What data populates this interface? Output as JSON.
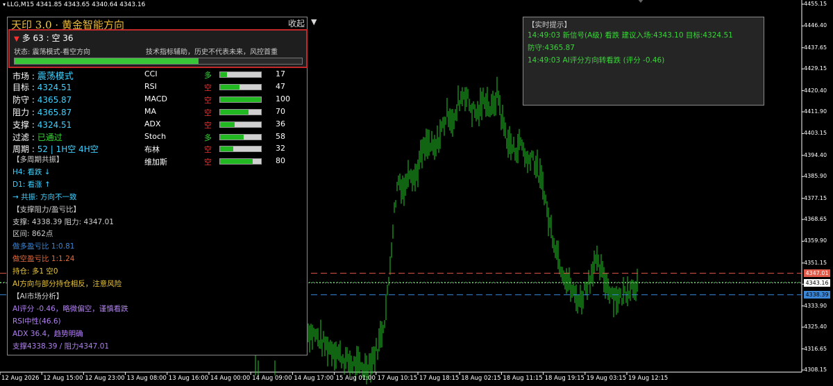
{
  "header": {
    "symbol_line": "LLG,M15  4341.85 4343.65 4340.64 4343.16"
  },
  "price_axis": {
    "labels": [
      "4455.15",
      "4446.40",
      "4437.65",
      "4429.15",
      "4420.40",
      "4411.90",
      "4403.15",
      "4394.40",
      "4385.90",
      "4377.15",
      "4368.65",
      "4359.90",
      "4351.15",
      "4342.65",
      "4333.90",
      "4325.40",
      "4316.65",
      "4308.15"
    ],
    "tags": [
      {
        "value": "4347.01",
        "color": "#e05a4a",
        "text_color": "#ffffff"
      },
      {
        "value": "4343.16",
        "color": "#ffffff",
        "text_color": "#000000"
      },
      {
        "value": "4338.39",
        "color": "#3b86d6",
        "text_color": "#000000"
      }
    ]
  },
  "time_axis": {
    "labels": [
      "12 Aug 2026",
      "12 Aug 15:00",
      "12 Aug 23:00",
      "13 Aug 08:00",
      "13 Aug 16:00",
      "14 Aug 00:00",
      "14 Aug 09:00",
      "14 Aug 17:00",
      "15 Aug 01:00",
      "17 Aug 10:15",
      "17 Aug 18:15",
      "18 Aug 02:15",
      "18 Aug 11:15",
      "18 Aug 19:15",
      "19 Aug 03:15",
      "19 Aug 12:15"
    ]
  },
  "chart_data": {
    "type": "candlestick",
    "symbol": "LLG",
    "timeframe": "M15",
    "ohlc_current": {
      "open": 4341.85,
      "high": 4343.65,
      "low": 4340.64,
      "close": 4343.16
    },
    "ylim": [
      4308.15,
      4455.15
    ],
    "candle_color": "#22c822",
    "background": "#000000",
    "grid": false,
    "horizontal_lines": [
      {
        "value": 4347.01,
        "style": "dashed",
        "color": "#e05a4a"
      },
      {
        "value": 4343.16,
        "style": "dotted",
        "color": "#9a9a9a"
      },
      {
        "value": 4338.39,
        "style": "dashed",
        "color": "#3b86d6"
      }
    ],
    "price_path": [
      [
        0.0,
        4324
      ],
      [
        0.03,
        4322
      ],
      [
        0.06,
        4318
      ],
      [
        0.09,
        4316
      ],
      [
        0.12,
        4312
      ],
      [
        0.15,
        4310
      ],
      [
        0.18,
        4309
      ],
      [
        0.2,
        4312
      ],
      [
        0.22,
        4318
      ],
      [
        0.24,
        4330
      ],
      [
        0.25,
        4342
      ],
      [
        0.26,
        4360
      ],
      [
        0.27,
        4375
      ],
      [
        0.28,
        4385
      ],
      [
        0.3,
        4380
      ],
      [
        0.31,
        4390
      ],
      [
        0.33,
        4385
      ],
      [
        0.35,
        4395
      ],
      [
        0.37,
        4399
      ],
      [
        0.39,
        4396
      ],
      [
        0.41,
        4405
      ],
      [
        0.43,
        4412
      ],
      [
        0.45,
        4407
      ],
      [
        0.46,
        4416
      ],
      [
        0.48,
        4420
      ],
      [
        0.5,
        4413
      ],
      [
        0.52,
        4411
      ],
      [
        0.54,
        4418
      ],
      [
        0.56,
        4412
      ],
      [
        0.58,
        4420
      ],
      [
        0.59,
        4410
      ],
      [
        0.61,
        4400
      ],
      [
        0.63,
        4396
      ],
      [
        0.65,
        4400
      ],
      [
        0.67,
        4391
      ],
      [
        0.68,
        4396
      ],
      [
        0.7,
        4388
      ],
      [
        0.72,
        4380
      ],
      [
        0.73,
        4370
      ],
      [
        0.75,
        4360
      ],
      [
        0.77,
        4350
      ],
      [
        0.79,
        4344
      ],
      [
        0.81,
        4338
      ],
      [
        0.83,
        4336
      ],
      [
        0.84,
        4340
      ],
      [
        0.86,
        4346
      ],
      [
        0.87,
        4352
      ],
      [
        0.89,
        4348
      ],
      [
        0.91,
        4342
      ],
      [
        0.93,
        4338
      ],
      [
        0.95,
        4337
      ],
      [
        0.97,
        4341
      ],
      [
        1.0,
        4343
      ]
    ]
  },
  "left_panel": {
    "title_prefix": "天印 ",
    "title_version": "3.0",
    "title_suffix": " · 黄金智能方向",
    "collapse_label": "收起",
    "collapse_arrow": "▼",
    "signal": {
      "arrow": "▼",
      "main": "多 63 : 空 36",
      "status": "状态: 震荡模式-看空方向",
      "note": "技术指标辅助，历史不代表未来，风控首重",
      "progress": 0.64
    },
    "stats": [
      {
        "label": "市场 : ",
        "value": "震荡模式",
        "style": "cyan-big"
      },
      {
        "label": "目标 : ",
        "value": "4324.51",
        "style": "cyan"
      },
      {
        "label": "防守 : ",
        "value": "4365.87",
        "style": "cyan"
      },
      {
        "label": "阻力 : ",
        "value": "4365.87",
        "style": "cyan"
      },
      {
        "label": "支撑 : ",
        "value": "4324.51",
        "style": "cyan"
      },
      {
        "label": "过滤 : ",
        "value": "已通过",
        "style": "green"
      },
      {
        "label": "周期 : ",
        "value": "52 | 1H空 4H空",
        "style": "cyan"
      }
    ],
    "indicators": [
      {
        "name": "CCI",
        "dir": "多",
        "dir_color": "#36d836",
        "value": 17,
        "label": "17"
      },
      {
        "name": "RSI",
        "dir": "空",
        "dir_color": "#ff2a2a",
        "value": 47,
        "label": "47"
      },
      {
        "name": "MACD",
        "dir": "空",
        "dir_color": "#ff2a2a",
        "value": 100,
        "label": "100"
      },
      {
        "name": "MA",
        "dir": "空",
        "dir_color": "#ff2a2a",
        "value": 70,
        "label": "70"
      },
      {
        "name": "ADX",
        "dir": "空",
        "dir_color": "#ff2a2a",
        "value": 36,
        "label": "36"
      },
      {
        "name": "Stoch",
        "dir": "多",
        "dir_color": "#36d836",
        "value": 58,
        "label": "58"
      },
      {
        "name": "布林",
        "dir": "空",
        "dir_color": "#ff2a2a",
        "value": 32,
        "label": "32"
      },
      {
        "name": "维加斯",
        "dir": "空",
        "dir_color": "#ff2a2a",
        "value": 80,
        "label": "80"
      }
    ],
    "sections": [
      {
        "text": "【多周期共振】",
        "color": "#d0d0d0"
      },
      {
        "text": "H4: 看跌 ↓",
        "color": "#3ed1ff"
      },
      {
        "text": "D1: 看涨 ↑",
        "color": "#3ed1ff"
      },
      {
        "text": "→ 共振: 方向不一致",
        "color": "#3ed1ff"
      },
      {
        "text": "【支撑阻力/盈亏比】",
        "color": "#d0d0d0"
      },
      {
        "text": "支撑: 4338.39  阻力: 4347.01",
        "color": "#d0d0d0"
      },
      {
        "text": "区间: 862点",
        "color": "#d0d0d0"
      },
      {
        "text": "做多盈亏比 1:0.81",
        "color": "#3b86d6"
      },
      {
        "text": "做空盈亏比 1:1.24",
        "color": "#e86a3a"
      },
      {
        "text": "持仓: 多1 空0",
        "color": "#e8c53a"
      },
      {
        "text": "AI方向与部分持仓相反，注意风险",
        "color": "#e8c53a"
      },
      {
        "text": "【AI市场分析】",
        "color": "#d0d0d0"
      },
      {
        "text": "AI评分 -0.46，略微偏空，谨慎看跌",
        "color": "#b080f0"
      },
      {
        "text": "RSI中性(46.6)",
        "color": "#b080f0"
      },
      {
        "text": "ADX 36.4，趋势明确",
        "color": "#b080f0"
      },
      {
        "text": "支撑4338.39 / 阻力4347.01",
        "color": "#b080f0"
      }
    ]
  },
  "alert_panel": {
    "title": "【实时提示】",
    "lines": [
      "14:49:03 新信号(A级) 看跌 建议入场:4343.10 目标:4324.51",
      "防守:4365.87",
      "14:49:03 AI评分方向转看跌 (评分 -0.46)"
    ]
  }
}
